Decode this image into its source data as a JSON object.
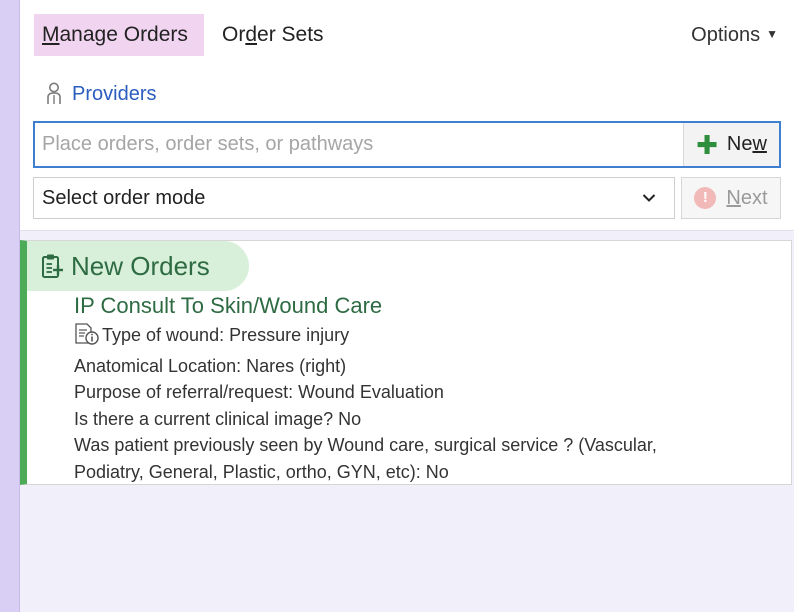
{
  "tabs": {
    "manage_prefix": "M",
    "manage_rest": "anage Orders",
    "ordersets_a": "Or",
    "ordersets_u": "d",
    "ordersets_b": "er Sets"
  },
  "options_label": "Options",
  "providers_label": "Providers",
  "search": {
    "placeholder": "Place orders, order sets, or pathways"
  },
  "new_button": {
    "a": "Ne",
    "u": "w"
  },
  "order_mode": {
    "selected": "Select order mode"
  },
  "next_button": {
    "u": "N",
    "b": "ext"
  },
  "new_orders": {
    "title": "New Orders",
    "order_name": "IP Consult To Skin/Wound Care",
    "details": [
      "Type of wound: Pressure injury",
      "Anatomical Location: Nares (right)",
      "Purpose of referral/request: Wound Evaluation",
      "Is there a current clinical image? No",
      "Was patient previously seen by Wound care, surgical service ? (Vascular,",
      "Podiatry, General, Plastic, ortho, GYN, etc): No"
    ]
  },
  "colors": {
    "accent_blue": "#3f7fd0",
    "active_tab_bg": "#f1d5f0",
    "new_orders_green": "#4daa57",
    "order_text_green": "#2e6b43"
  },
  "icons": {
    "providers": "person-icon",
    "new": "plus-icon",
    "next": "warning-icon",
    "new_orders": "clipboard-plus-icon",
    "detail": "document-info-icon"
  }
}
